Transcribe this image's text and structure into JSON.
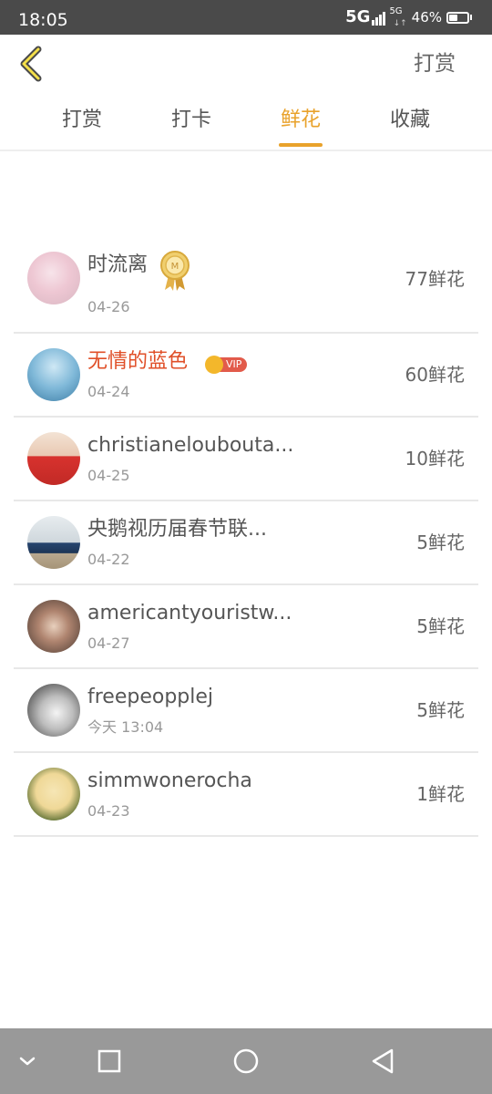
{
  "status_bar": {
    "time": "18:05",
    "network": "5G",
    "network_secondary": "5G",
    "battery_percent": "46%",
    "battery_level": 0.46
  },
  "header": {
    "back_icon": "chevron-left-icon",
    "action_label": "打赏"
  },
  "tabs": [
    {
      "label": "打赏",
      "active": false
    },
    {
      "label": "打卡",
      "active": false
    },
    {
      "label": "鲜花",
      "active": true
    },
    {
      "label": "收藏",
      "active": false
    }
  ],
  "list": [
    {
      "name": "时流离",
      "date": "04-26",
      "count": "77鲜花",
      "badge": "medal"
    },
    {
      "name": "无情的蓝色",
      "date": "04-24",
      "count": "60鲜花",
      "badge": "vip",
      "badge_text": "VIP"
    },
    {
      "name": "christianelouboutа...",
      "date": "04-25",
      "count": "10鲜花"
    },
    {
      "name": "央鹅视历届春节联...",
      "date": "04-22",
      "count": "5鲜花"
    },
    {
      "name": "americantyouristw...",
      "date": "04-27",
      "count": "5鲜花"
    },
    {
      "name": "freepeopplej",
      "date": "今天 13:04",
      "count": "5鲜花"
    },
    {
      "name": "simmwonerocha",
      "date": "04-23",
      "count": "1鲜花"
    }
  ],
  "nav_bar": {
    "icons": [
      "chevron-down-icon",
      "recent-apps-icon",
      "home-icon",
      "back-triangle-icon"
    ]
  },
  "colors": {
    "accent": "#e9a22b",
    "vip_name": "#e04f28",
    "nav_bar": "#999999",
    "status_bar": "#4a4a4a"
  }
}
